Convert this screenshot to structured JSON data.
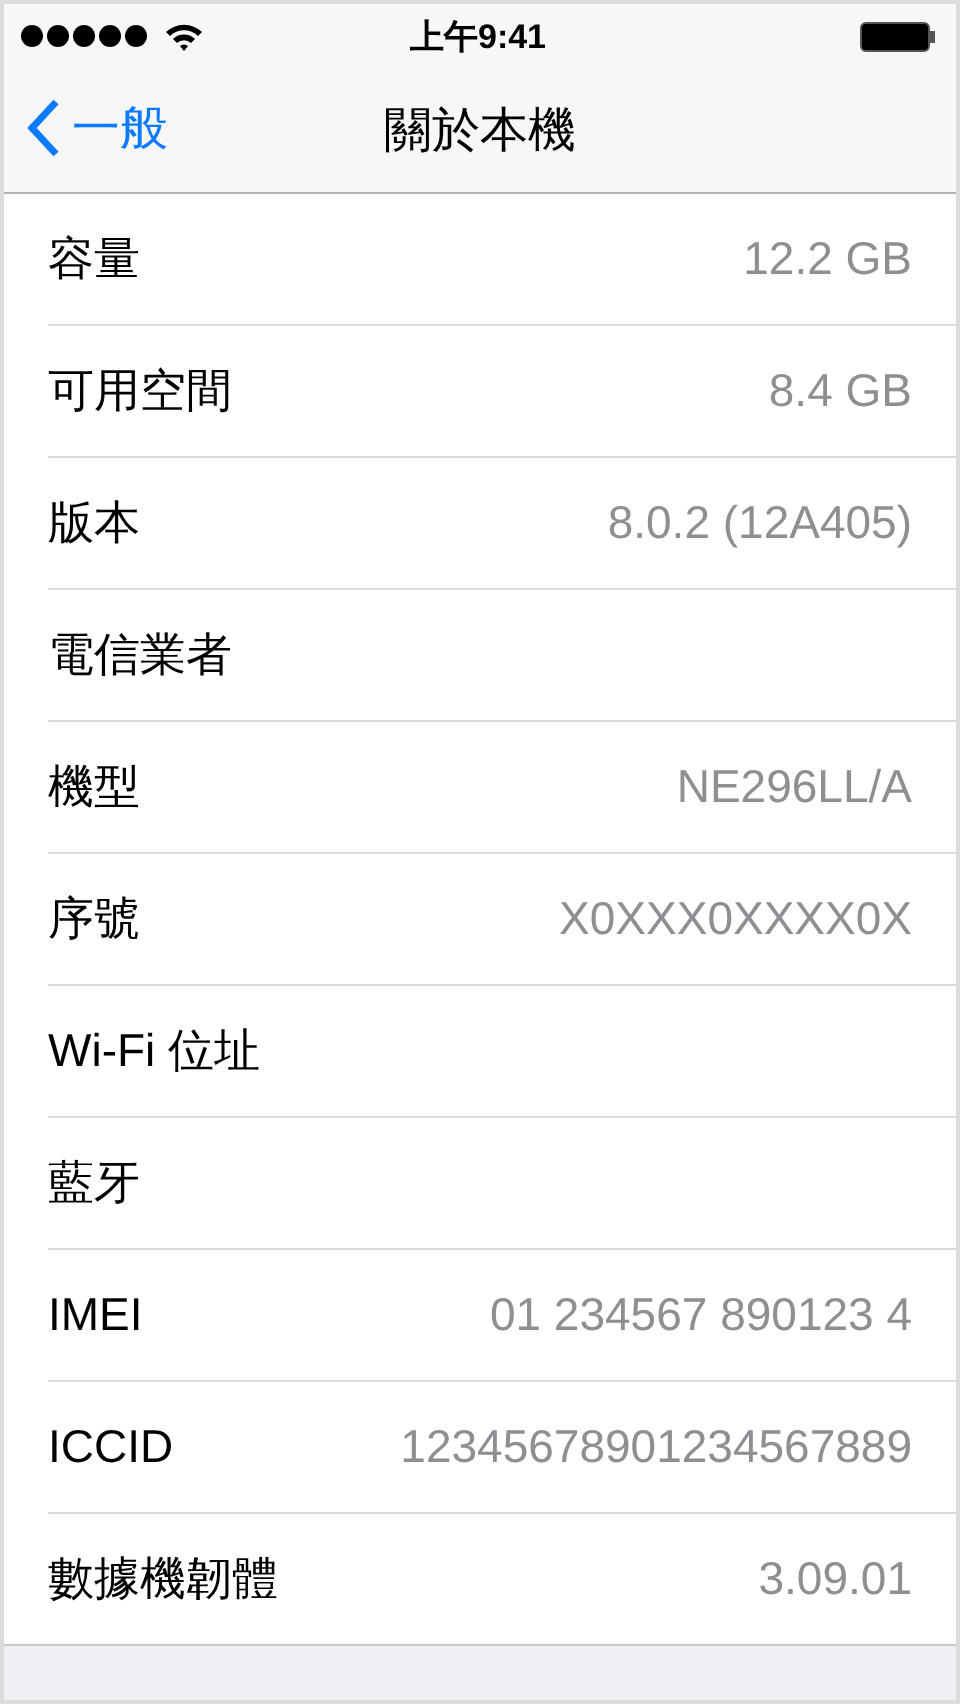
{
  "status_bar": {
    "time": "上午9:41"
  },
  "nav_bar": {
    "back": "一般",
    "title": "關於本機"
  },
  "rows": [
    {
      "label": "容量",
      "value": "12.2 GB"
    },
    {
      "label": "可用空間",
      "value": "8.4 GB"
    },
    {
      "label": "版本",
      "value": "8.0.2 (12A405)"
    },
    {
      "label": "電信業者"
    },
    {
      "label": "機型",
      "value": "NE296LL/A"
    },
    {
      "label": "序號",
      "value": "X0XXX0XXXX0X"
    },
    {
      "label": "Wi-Fi 位址"
    },
    {
      "label": "藍牙"
    },
    {
      "label": "IMEI",
      "value": "01 234567 890123 4"
    },
    {
      "label": "ICCID",
      "value": "12345678901234567889"
    },
    {
      "label": "數據機韌體",
      "value": "3.09.01"
    }
  ]
}
